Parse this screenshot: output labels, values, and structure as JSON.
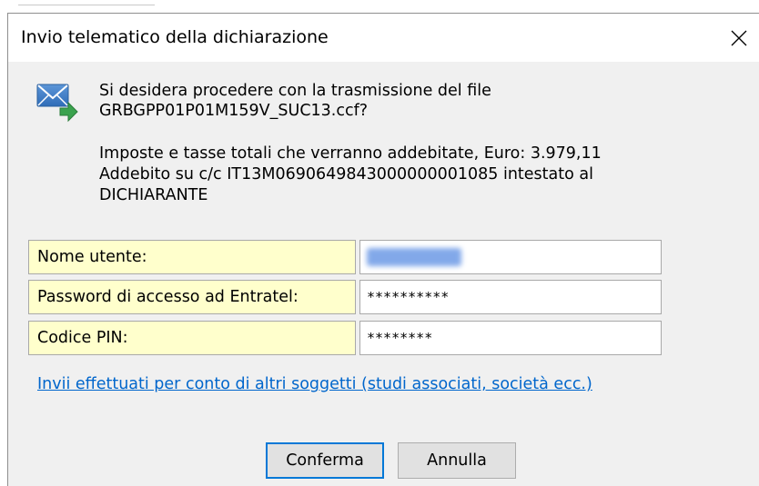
{
  "window": {
    "title": "Invio telematico della dichiarazione",
    "close_glyph": "✕"
  },
  "message": {
    "icon": "mail-send-icon",
    "question_line1": "Si desidera procedere con la trasmissione del file",
    "question_line2": "GRBGPP01P01M159V_SUC13.ccf?",
    "detail_line1": "Imposte e tasse totali che verranno addebitate, Euro: 3.979,11",
    "detail_line2": "Addebito su c/c IT13M0690649843000000001085 intestato al",
    "detail_line3": "DICHIARANTE"
  },
  "form": {
    "username_label": "Nome utente:",
    "username_value_redacted": true,
    "password_label": "Password di accesso ad Entratel:",
    "password_value": "**********",
    "pin_label": "Codice PIN:",
    "pin_value": "********"
  },
  "link": {
    "text": "Invii effettuati per conto di altri soggetti (studi associati, società ecc.)"
  },
  "buttons": {
    "confirm": "Conferma",
    "cancel": "Annulla"
  },
  "colors": {
    "label_bg": "#ffffcc",
    "link": "#0066cc",
    "default_button_border": "#0078d7",
    "dialog_bg": "#f0f0f0"
  }
}
